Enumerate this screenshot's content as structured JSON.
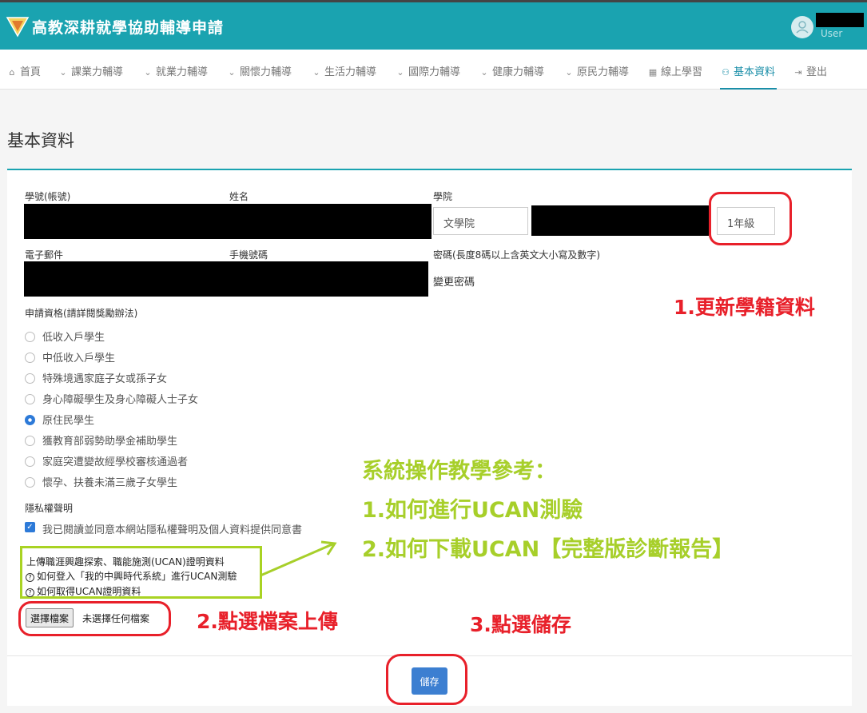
{
  "app": {
    "title": "高教深耕就學協助輔導申請",
    "user_label": "User"
  },
  "nav": [
    {
      "icon": "home-icon",
      "label": "首頁"
    },
    {
      "icon": "chevron-down-icon",
      "label": "課業力輔導"
    },
    {
      "icon": "chevron-down-icon",
      "label": "就業力輔導"
    },
    {
      "icon": "chevron-down-icon",
      "label": "關懷力輔導"
    },
    {
      "icon": "chevron-down-icon",
      "label": "生活力輔導"
    },
    {
      "icon": "chevron-down-icon",
      "label": "國際力輔導"
    },
    {
      "icon": "chevron-down-icon",
      "label": "健康力輔導"
    },
    {
      "icon": "chevron-down-icon",
      "label": "原民力輔導"
    },
    {
      "icon": "film-icon",
      "label": "線上學習"
    },
    {
      "icon": "user-icon",
      "label": "基本資料"
    },
    {
      "icon": "logout-icon",
      "label": "登出"
    }
  ],
  "active_tab": "基本資料",
  "page_title": "基本資料",
  "form": {
    "student_id_label": "學號(帳號)",
    "name_label": "姓名",
    "college_label": "學院",
    "college_value": "文學院",
    "grade_value": "1年級",
    "email_label": "電子郵件",
    "phone_label": "手機號碼",
    "password_label": "密碼(長度8碼以上含英文大小寫及數字)",
    "change_password": "變更密碼",
    "eligibility_label": "申請資格(請詳閱獎勵辦法)",
    "eligibility_options": [
      "低收入戶學生",
      "中低收入戶學生",
      "特殊境遇家庭子女或孫子女",
      "身心障礙學生及身心障礙人士子女",
      "原住民學生",
      "獲教育部弱勢助學金補助學生",
      "家庭突遭變故經學校審核通過者",
      "懷孕、扶養未滿三歲子女學生"
    ],
    "eligibility_selected": "原住民學生",
    "privacy_label": "隱私權聲明",
    "privacy_agree": "我已閱讀並同意本網站隱私權聲明及個人資料提供同意書",
    "upload_title": "上傳職涯興趣探索、職能施測(UCAN)證明資料",
    "upload_help_1": "如何登入「我的中興時代系統」進行UCAN測驗",
    "upload_help_2": "如何取得UCAN證明資料",
    "file_button": "選擇檔案",
    "file_none": "未選擇任何檔案",
    "save_button": "儲存"
  },
  "annotations": {
    "step1": "1.更新學籍資料",
    "step2": "2.點選檔案上傳",
    "step3": "3.點選儲存",
    "tutorial_title": "系統操作教學參考：",
    "tutorial_1": "1.如何進行UCAN測驗",
    "tutorial_2": "2.如何下載UCAN【完整版診斷報告】",
    "color_red": "#e8202a",
    "color_green": "#a7cf2a"
  }
}
